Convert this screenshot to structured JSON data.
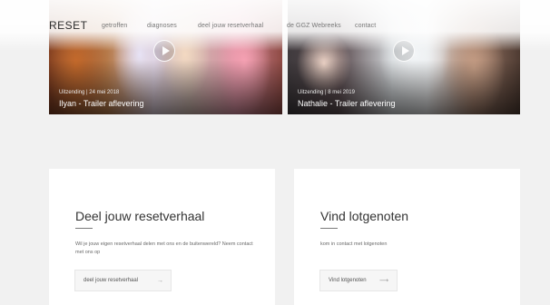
{
  "nav": {
    "brand": "RESET",
    "links": [
      {
        "label": "getroffen"
      },
      {
        "label": "diagnoses"
      },
      {
        "label": "deel jouw resetverhaal"
      },
      {
        "label": "de GGZ Webreeks"
      },
      {
        "label": "contact"
      }
    ]
  },
  "videos": [
    {
      "meta": "Uitzending | 24 mei 2018",
      "title": "Ilyan - Trailer aflevering"
    },
    {
      "meta": "Uitzending | 8 mei 2019",
      "title": "Nathalie - Trailer aflevering"
    }
  ],
  "cards": [
    {
      "title": "Deel jouw resetverhaal",
      "text": "Wil je jouw eigen resetverhaal delen met ons en de buitenwereld? Neem contact met ons op",
      "button": "deel jouw resetverhaal",
      "arrow": "→"
    },
    {
      "title": "Vind lotgenoten",
      "text": "kom in contact met lotgenoten",
      "button": "Vind lotgenoten",
      "arrow": "⟶"
    }
  ],
  "colors": {
    "background": "#f1f1f1",
    "card": "#ffffff",
    "text": "#333333"
  },
  "icons": {
    "play": "play-icon",
    "arrow": "arrow-right-icon"
  }
}
